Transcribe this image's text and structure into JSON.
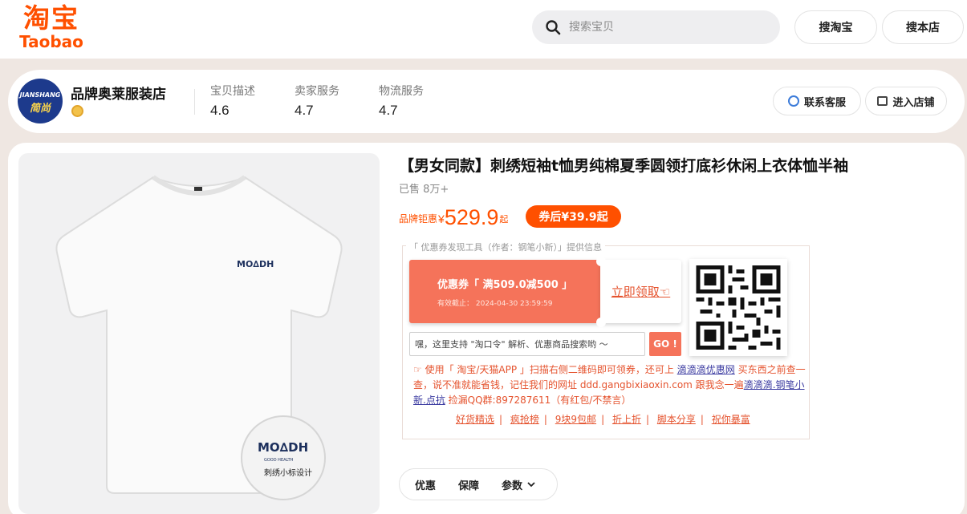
{
  "header": {
    "logo_cn": "淘宝",
    "logo_en": "Taobao",
    "search_placeholder": "搜索宝贝",
    "search_taobao_label": "搜淘宝",
    "search_store_label": "搜本店"
  },
  "shop": {
    "avatar_top": "JIANSHANG",
    "avatar_bottom": "简尚",
    "name": "品牌奥莱服装店",
    "ratings": [
      {
        "label": "宝贝描述",
        "value": "4.6"
      },
      {
        "label": "卖家服务",
        "value": "4.7"
      },
      {
        "label": "物流服务",
        "value": "4.7"
      }
    ],
    "contact_label": "联系客服",
    "enter_label": "进入店铺"
  },
  "product": {
    "title": "【男女同款】刺绣短袖t恤男纯棉夏季圆领打底衫休闲上衣体恤半袖",
    "sold": "已售 8万+",
    "price_label": "品牌钜惠",
    "price_currency": "¥",
    "price_value": "529.9",
    "price_suffix": "起",
    "coupon_price": "券后¥39.9起",
    "shirt_logo_main": "MO∆DH",
    "shirt_logo_sub": "GOOD HEALTH",
    "zoom_caption": "刺绣小标设计"
  },
  "coupon_tool": {
    "caption": "「 优惠券发现工具（作者：钢笔小新）」提供信息",
    "coupon_text": "优惠券「 满509.0减500 」",
    "expire_text": "有效截止： 2024-04-30 23:59:59",
    "claim_label": "立即领取☜",
    "input_placeholder": "嘿，这里支持 \"淘口令\" 解析、优惠商品搜索哟 ～",
    "go_label": "GO !",
    "info_part1": "☞ 使用「 淘宝/天猫APP 」扫描右侧二维码即可领券，还可上 ",
    "info_link1": "滴滴滴优惠网",
    "info_part2": " 买东西之前查一查，说不准就能省钱，记住我们的网址 ddd.gangbixiaoxin.com 跟我念一遍",
    "info_link2": "滴滴滴.钢笔小新.点抗",
    "info_part3": " 捡漏QQ群:897287611（有红包/不禁言）",
    "links": [
      "好货精选",
      "疯抢榜",
      "9块9包邮",
      "折上折",
      "脚本分享",
      "祝你暴富"
    ]
  },
  "tabs": [
    "优惠",
    "保障",
    "参数"
  ]
}
